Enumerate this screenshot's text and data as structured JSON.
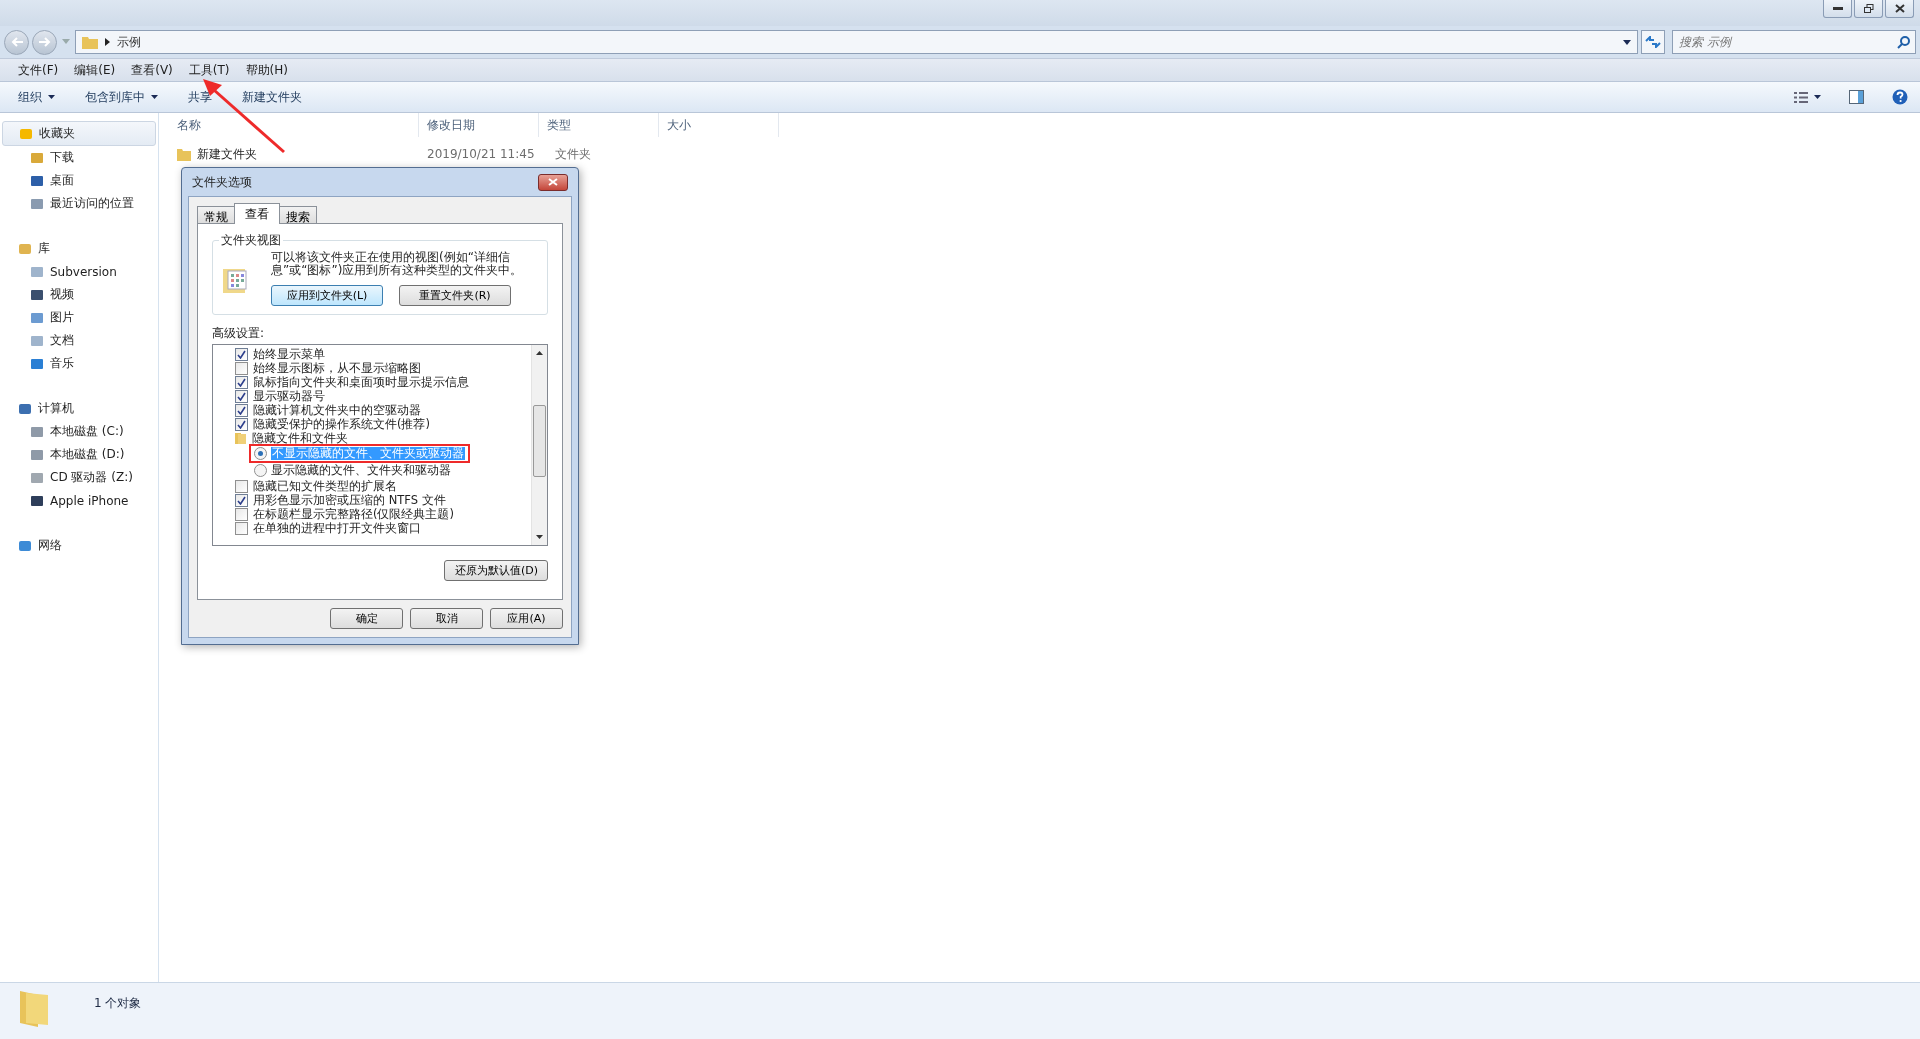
{
  "address": {
    "path": "示例",
    "search_placeholder": "搜索 示例"
  },
  "menu": [
    "文件(F)",
    "编辑(E)",
    "查看(V)",
    "工具(T)",
    "帮助(H)"
  ],
  "toolbar": [
    {
      "label": "组织",
      "dropdown": true
    },
    {
      "label": "包含到库中",
      "dropdown": true
    },
    {
      "label": "共享",
      "dropdown": false
    },
    {
      "label": "新建文件夹",
      "dropdown": false
    }
  ],
  "sidebar": {
    "items": [
      {
        "label": "收藏夹",
        "kind": "star",
        "selected": true,
        "children": [
          {
            "label": "下载",
            "kind": "download",
            "selected": false
          },
          {
            "label": "桌面",
            "kind": "desktop",
            "selected": false
          },
          {
            "label": "最近访问的位置",
            "kind": "recent",
            "selected": false
          }
        ]
      },
      {
        "label": "库",
        "kind": "library",
        "selected": false,
        "children": [
          {
            "label": "Subversion",
            "kind": "doc",
            "selected": false
          },
          {
            "label": "视频",
            "kind": "video",
            "selected": false
          },
          {
            "label": "图片",
            "kind": "picture",
            "selected": false
          },
          {
            "label": "文档",
            "kind": "doc",
            "selected": false
          },
          {
            "label": "音乐",
            "kind": "music",
            "selected": false
          }
        ]
      },
      {
        "label": "计算机",
        "kind": "computer",
        "selected": false,
        "children": [
          {
            "label": "本地磁盘 (C:)",
            "kind": "disk",
            "selected": false
          },
          {
            "label": "本地磁盘 (D:)",
            "kind": "disk",
            "selected": false
          },
          {
            "label": "CD 驱动器 (Z:)",
            "kind": "cd",
            "selected": false
          },
          {
            "label": "Apple iPhone",
            "kind": "phone",
            "selected": false
          }
        ]
      },
      {
        "label": "网络",
        "kind": "network",
        "selected": false
      }
    ]
  },
  "table": {
    "columns": [
      "名称",
      "修改日期",
      "类型",
      "大小"
    ],
    "rows": [
      {
        "name": "新建文件夹",
        "modified": "2019/10/21 11:45",
        "type": "文件夹"
      }
    ]
  },
  "dialog": {
    "title": "文件夹选项",
    "tabs": [
      {
        "label": "常规",
        "selected": false
      },
      {
        "label": "查看",
        "selected": true
      },
      {
        "label": "搜索",
        "selected": false
      }
    ],
    "group_title": "文件夹视图",
    "group_text": "可以将该文件夹正在使用的视图(例如“详细信息”或“图标”)应用到所有这种类型的文件夹中。",
    "group_buttons": [
      {
        "label": "应用到文件夹(L)",
        "focused": true
      },
      {
        "label": "重置文件夹(R)",
        "focused": false
      }
    ],
    "advanced_label": "高级设置:",
    "advanced": [
      {
        "kind": "checkbox",
        "label": "始终显示菜单",
        "checked": true
      },
      {
        "kind": "checkbox",
        "label": "始终显示图标，从不显示缩略图",
        "checked": false
      },
      {
        "kind": "checkbox",
        "label": "鼠标指向文件夹和桌面项时显示提示信息",
        "checked": true
      },
      {
        "kind": "checkbox",
        "label": "显示驱动器号",
        "checked": true
      },
      {
        "kind": "checkbox",
        "label": "隐藏计算机文件夹中的空驱动器",
        "checked": true
      },
      {
        "kind": "checkbox",
        "label": "隐藏受保护的操作系统文件(推荐)",
        "checked": true
      },
      {
        "kind": "folder",
        "label": "隐藏文件和文件夹"
      },
      {
        "kind": "radio",
        "label": "不显示隐藏的文件、文件夹或驱动器",
        "selected": true,
        "annotated": true
      },
      {
        "kind": "radio",
        "label": "显示隐藏的文件、文件夹和驱动器",
        "selected": false,
        "annotated": false
      },
      {
        "kind": "checkbox",
        "label": "隐藏已知文件类型的扩展名",
        "checked": false
      },
      {
        "kind": "checkbox",
        "label": "用彩色显示加密或压缩的 NTFS 文件",
        "checked": true
      },
      {
        "kind": "checkbox",
        "label": "在标题栏显示完整路径(仅限经典主题)",
        "checked": false
      },
      {
        "kind": "checkbox",
        "label": "在单独的进程中打开文件夹窗口",
        "checked": false
      }
    ],
    "restore_button": "还原为默认值(D)",
    "buttons": [
      "确定",
      "取消",
      "应用(A)"
    ]
  },
  "status_bar": {
    "count": "1 个对象"
  },
  "annotation_arrow": true
}
